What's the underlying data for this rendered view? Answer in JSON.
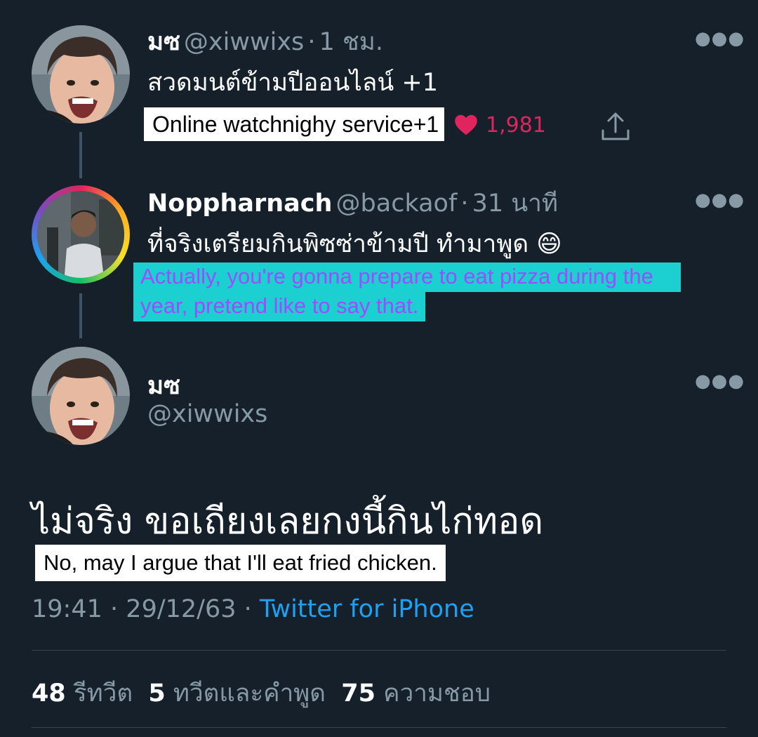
{
  "reply_chain": [
    {
      "display_name": "มซ",
      "handle": "@xiwwixs",
      "separator": "·",
      "time_ago": "1 ชม.",
      "text": "สวดมนต์ข้ามปีออนไลน์ +1",
      "translation": "Online watchnighy service+1",
      "like_count": "1,981"
    },
    {
      "display_name": "Noppharnach",
      "handle": "@backaof",
      "separator": "·",
      "time_ago": "31 นาที",
      "text": "ที่จริงเตรียมกินพิซซ่าข้ามปี ทำมาพูด",
      "emoji": "😄",
      "translation_line1": "Actually, you're gonna prepare to eat pizza during the",
      "translation_line2": "year,  pretend like to say that."
    }
  ],
  "main_tweet": {
    "display_name": "มซ",
    "handle": "@xiwwixs",
    "text": "ไม่จริง ขอเถียงเลยกงนี้กินไก่ทอด",
    "translation": "No, may I argue that I'll eat fried chicken.",
    "time": "19:41",
    "separator": "·",
    "date": "29/12/63",
    "separator2": "·",
    "client": "Twitter for iPhone"
  },
  "stats": {
    "retweets_count": "48",
    "retweets_label": "รีทวีต",
    "quotes_count": "5",
    "quotes_label": "ทวีตและคำพูด",
    "likes_count": "75",
    "likes_label": "ความชอบ"
  },
  "icons": {
    "more": "more-dots-icon",
    "like": "heart-icon",
    "share": "share-icon"
  },
  "colors": {
    "background": "#15202b",
    "secondary_text": "#8899a6",
    "like": "#e0245e",
    "link": "#1da1f2",
    "cyan_highlight": "#1ccfd0",
    "purple_caption": "#9b4dff"
  }
}
